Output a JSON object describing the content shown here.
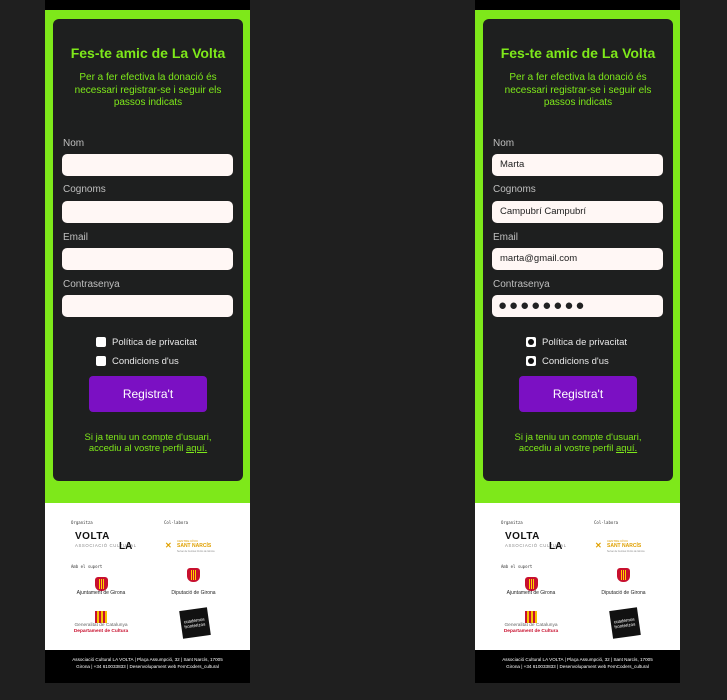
{
  "title": "Fes-te amic de La Volta",
  "subtitle": "Per a fer efectiva la donació és necessari registrar-se i seguir els passos indicats",
  "labels": {
    "nom": "Nom",
    "cognoms": "Cognoms",
    "email": "Email",
    "password": "Contrasenya"
  },
  "checks": {
    "privacy": "Política de privacitat",
    "terms": "Condicions d'us"
  },
  "register_button": "Registra't",
  "login_text": "Si ja teniu un compte d'usuari, accediu al vostre perfil",
  "login_link": "aquí.",
  "filled": {
    "nom": "Marta",
    "cognoms": "Campubrí Campubrí",
    "email": "marta@gmail.com",
    "password_mask": "●●●●●●●●"
  },
  "sponsors": {
    "organitza": "Organitza",
    "col_labora": "Col·labora",
    "amb_suport": "Amb el suport",
    "volta": "VOLTA",
    "volta_sub": "ASSOCIACIÓ CULTURAL",
    "volta_la": "LA",
    "sant_narcis_top": "CENTRE CÍVIC",
    "sant_narcis": "SANT NARCÍS",
    "sant_narcis_sub": "Servei de Centres Cívics de Girona",
    "ajuntament": "Ajuntament de Girona",
    "diputacio": "Diputació de Girona",
    "generalitat": "Generalitat de Catalunya",
    "departament": "Departament de Cultura",
    "cuadernos": "cuadernos fronterizos"
  },
  "footer_line1": "Associació Cultural LA VOLTA | Plaça Assumpció, 32 | Sant Narcís, 17005",
  "footer_line2": "Girona | +34 610033833 | Desenvolupament web FemCoders_cultural",
  "colors": {
    "accent": "#7ee81a",
    "button": "#7b10c3",
    "card": "#1e1f1f"
  }
}
